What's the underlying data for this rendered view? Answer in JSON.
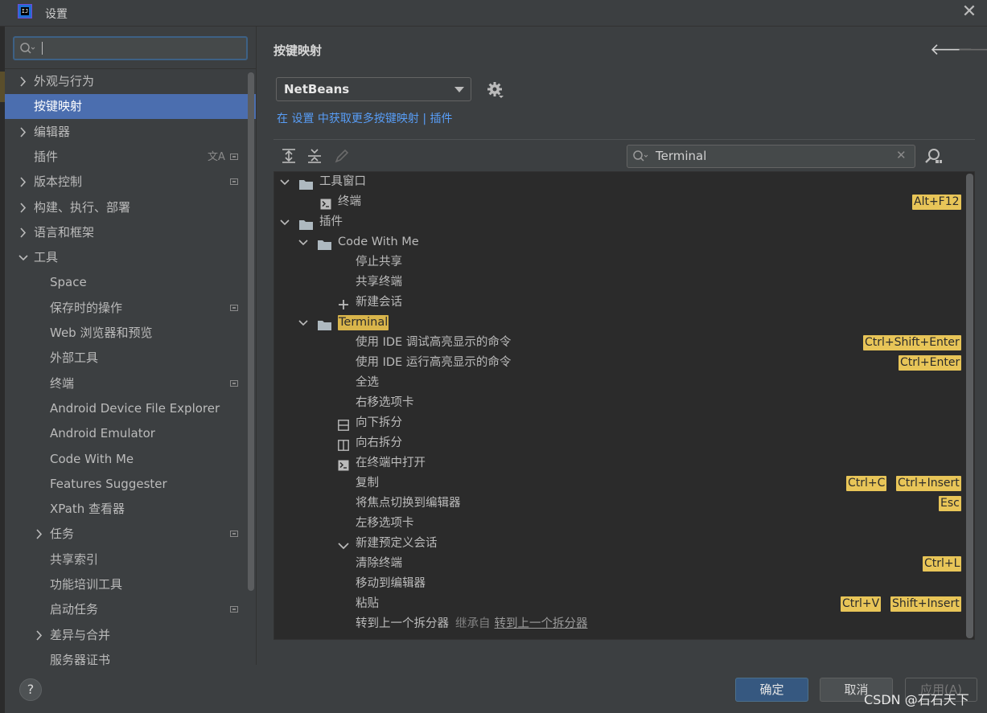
{
  "window": {
    "title": "设置",
    "logo_text": "IJ"
  },
  "sidebar": {
    "search": {
      "value": ""
    },
    "items": [
      {
        "label": "外观与行为",
        "expandable": true,
        "expanded": false
      },
      {
        "label": "按键映射",
        "selected": true
      },
      {
        "label": "编辑器",
        "expandable": true,
        "expanded": false
      },
      {
        "label": "插件",
        "translate_icon": "文A",
        "badge": true
      },
      {
        "label": "版本控制",
        "expandable": true,
        "expanded": false,
        "badge": true
      },
      {
        "label": "构建、执行、部署",
        "expandable": true,
        "expanded": false
      },
      {
        "label": "语言和框架",
        "expandable": true,
        "expanded": false
      },
      {
        "label": "工具",
        "expandable": true,
        "expanded": true
      },
      {
        "label": "Space",
        "indent": 1
      },
      {
        "label": "保存时的操作",
        "indent": 1,
        "badge": true
      },
      {
        "label": "Web 浏览器和预览",
        "indent": 1
      },
      {
        "label": "外部工具",
        "indent": 1
      },
      {
        "label": "终端",
        "indent": 1,
        "badge": true
      },
      {
        "label": "Android Device File Explorer",
        "indent": 1
      },
      {
        "label": "Android Emulator",
        "indent": 1
      },
      {
        "label": "Code With Me",
        "indent": 1
      },
      {
        "label": "Features Suggester",
        "indent": 1
      },
      {
        "label": "XPath 查看器",
        "indent": 1
      },
      {
        "label": "任务",
        "indent": 1,
        "expandable": true,
        "expanded": false,
        "badge": true
      },
      {
        "label": "共享索引",
        "indent": 1
      },
      {
        "label": "功能培训工具",
        "indent": 1
      },
      {
        "label": "启动任务",
        "indent": 1,
        "badge": true
      },
      {
        "label": "差异与合并",
        "indent": 1,
        "expandable": true,
        "expanded": false
      },
      {
        "label": "服务器证书",
        "indent": 1
      }
    ]
  },
  "main": {
    "title": "按键映射",
    "keymap": {
      "selected": "NetBeans"
    },
    "links": {
      "prefix": "在 ",
      "settings": "设置",
      "middle": " 中获取更多按键映射 | ",
      "plugins": "插件"
    },
    "filter": {
      "value": "Terminal"
    }
  },
  "tree": [
    {
      "label": "工具窗口",
      "level": 0,
      "icon": "folder",
      "chevron": "down"
    },
    {
      "label": "终端",
      "level": 1,
      "icon": "terminal",
      "shortcuts": [
        "Alt+F12"
      ]
    },
    {
      "label": "插件",
      "level": 0,
      "icon": "folder",
      "chevron": "down"
    },
    {
      "label": "Code With Me",
      "level": 1,
      "icon": "folder",
      "chevron": "down"
    },
    {
      "label": "停止共享",
      "level": 2
    },
    {
      "label": "共享终端",
      "level": 2
    },
    {
      "label": "新建会话",
      "level": 2,
      "icon": "plus"
    },
    {
      "label": "Terminal",
      "level": 1,
      "icon": "folder",
      "chevron": "down",
      "highlight": true
    },
    {
      "label": "使用 IDE 调试高亮显示的命令",
      "level": 2,
      "shortcuts": [
        "Ctrl+Shift+Enter"
      ]
    },
    {
      "label": "使用 IDE 运行高亮显示的命令",
      "level": 2,
      "shortcuts": [
        "Ctrl+Enter"
      ]
    },
    {
      "label": "全选",
      "level": 2
    },
    {
      "label": "右移选项卡",
      "level": 2
    },
    {
      "label": "向下拆分",
      "level": 2,
      "icon": "split-down"
    },
    {
      "label": "向右拆分",
      "level": 2,
      "icon": "split-right"
    },
    {
      "label": "在终端中打开",
      "level": 2,
      "icon": "terminal"
    },
    {
      "label": "复制",
      "level": 2,
      "shortcuts": [
        "Ctrl+C",
        "Ctrl+Insert"
      ]
    },
    {
      "label": "将焦点切换到编辑器",
      "level": 2,
      "shortcuts": [
        "Esc"
      ]
    },
    {
      "label": "左移选项卡",
      "level": 2
    },
    {
      "label": "新建预定义会话",
      "level": 2,
      "icon": "chevron-down"
    },
    {
      "label": "清除终端",
      "level": 2,
      "shortcuts": [
        "Ctrl+L"
      ]
    },
    {
      "label": "移动到编辑器",
      "level": 2
    },
    {
      "label": "粘贴",
      "level": 2,
      "shortcuts": [
        "Ctrl+V",
        "Shift+Insert"
      ]
    },
    {
      "label": "转到上一个拆分器",
      "level": 2,
      "inherit_prefix": "继承自",
      "inherit_link": "转到上一个拆分器"
    }
  ],
  "footer": {
    "help": "?",
    "ok": "确定",
    "cancel": "取消",
    "apply": "应用(A)",
    "watermark": "CSDN @石石天下"
  },
  "colors": {
    "accent": "#4b6eaf",
    "highlight": "#e8c558",
    "link": "#589df6",
    "primary_button": "#365880"
  }
}
